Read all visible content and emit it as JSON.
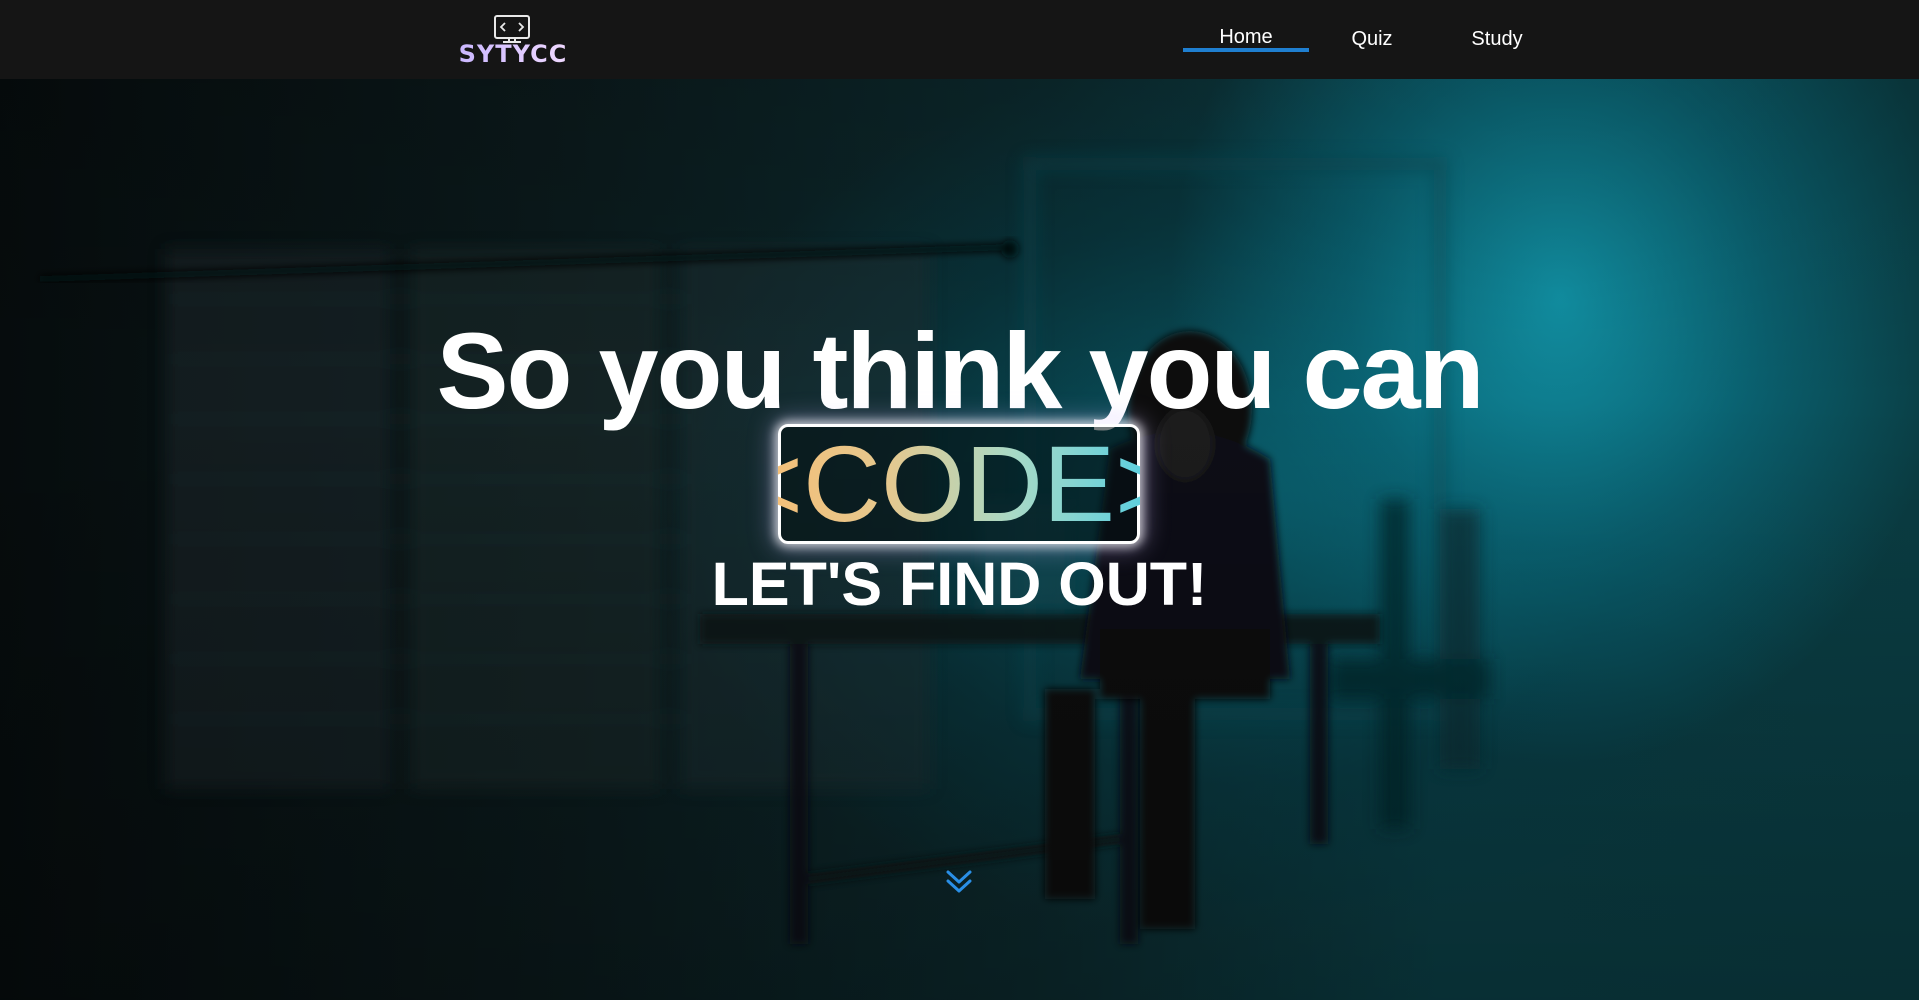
{
  "header": {
    "logo_text": "SYTYCC",
    "nav": [
      {
        "label": "Home",
        "active": true
      },
      {
        "label": "Quiz",
        "active": false
      },
      {
        "label": "Study",
        "active": false
      }
    ]
  },
  "hero": {
    "headline": "So you think you can",
    "code_word": "<CODE>",
    "subhead": "LET'S FIND OUT!",
    "scroll_icon": "double-chevron-down-icon"
  },
  "colors": {
    "navbar_bg": "#151515",
    "active_underline": "#1f7fd0",
    "scroll_icon": "#2a8fe6",
    "code_gradient": [
      "#f3c07a",
      "#a8d9c6",
      "#5fd0de"
    ]
  }
}
